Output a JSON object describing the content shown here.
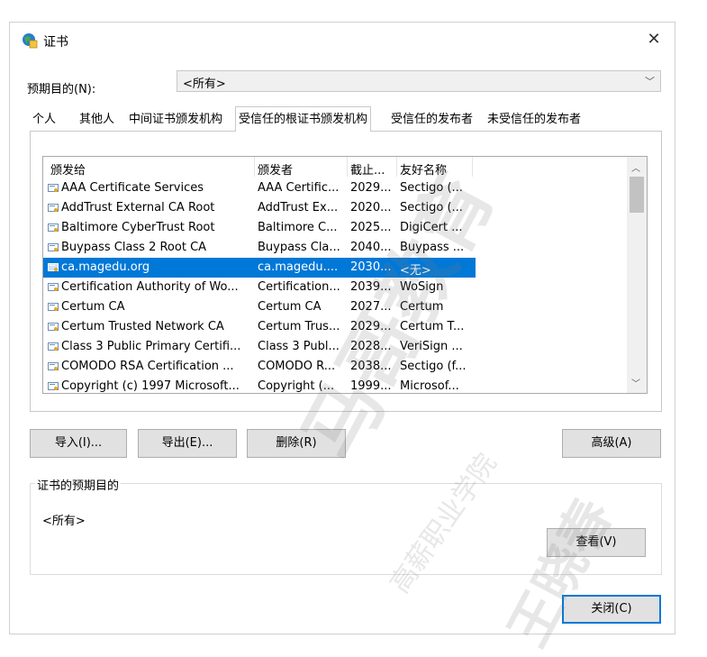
{
  "window": {
    "title": "证书"
  },
  "purpose": {
    "label": "预期目的(N):",
    "value": "<所有>"
  },
  "tabs": [
    {
      "label": "个人"
    },
    {
      "label": "其他人"
    },
    {
      "label": "中间证书颁发机构"
    },
    {
      "label": "受信任的根证书颁发机构"
    },
    {
      "label": "受信任的发布者"
    },
    {
      "label": "未受信任的发布者"
    }
  ],
  "list": {
    "headers": [
      "颁发给",
      "颁发者",
      "截止...",
      "友好名称"
    ],
    "rows": [
      {
        "issued_to": "AAA Certificate Services",
        "issuer": "AAA Certific...",
        "expires": "2029...",
        "friendly": "Sectigo (..."
      },
      {
        "issued_to": "AddTrust External CA Root",
        "issuer": "AddTrust Ex...",
        "expires": "2020...",
        "friendly": "Sectigo (..."
      },
      {
        "issued_to": "Baltimore CyberTrust Root",
        "issuer": "Baltimore C...",
        "expires": "2025...",
        "friendly": "DigiCert ..."
      },
      {
        "issued_to": "Buypass Class 2 Root CA",
        "issuer": "Buypass Cla...",
        "expires": "2040...",
        "friendly": "Buypass ..."
      },
      {
        "issued_to": "ca.magedu.org",
        "issuer": "ca.magedu....",
        "expires": "2030...",
        "friendly": "<无>"
      },
      {
        "issued_to": "Certification Authority of Wo...",
        "issuer": "Certification...",
        "expires": "2039...",
        "friendly": "WoSign"
      },
      {
        "issued_to": "Certum CA",
        "issuer": "Certum CA",
        "expires": "2027...",
        "friendly": "Certum"
      },
      {
        "issued_to": "Certum Trusted Network CA",
        "issuer": "Certum Trus...",
        "expires": "2029...",
        "friendly": "Certum T..."
      },
      {
        "issued_to": "Class 3 Public Primary Certifi...",
        "issuer": "Class 3 Publ...",
        "expires": "2028...",
        "friendly": "VeriSign ..."
      },
      {
        "issued_to": "COMODO RSA Certification ...",
        "issuer": "COMODO R...",
        "expires": "2038...",
        "friendly": "Sectigo (f..."
      },
      {
        "issued_to": "Copyright (c) 1997 Microsoft...",
        "issuer": "Copyright (...",
        "expires": "1999...",
        "friendly": "Microsof..."
      }
    ],
    "selected_index": 4
  },
  "buttons": {
    "import": "导入(I)...",
    "export": "导出(E)...",
    "remove": "删除(R)",
    "advanced": "高级(A)",
    "view": "查看(V)",
    "close": "关闭(C)"
  },
  "purposes_group": {
    "title": "证书的预期目的",
    "value": "<所有>"
  },
  "watermark": {
    "brand": "马哥教育",
    "org": "高薪职业学院",
    "name": "王晓春"
  },
  "colors": {
    "selection": "#0078d7",
    "button_face": "#e1e1e1"
  }
}
